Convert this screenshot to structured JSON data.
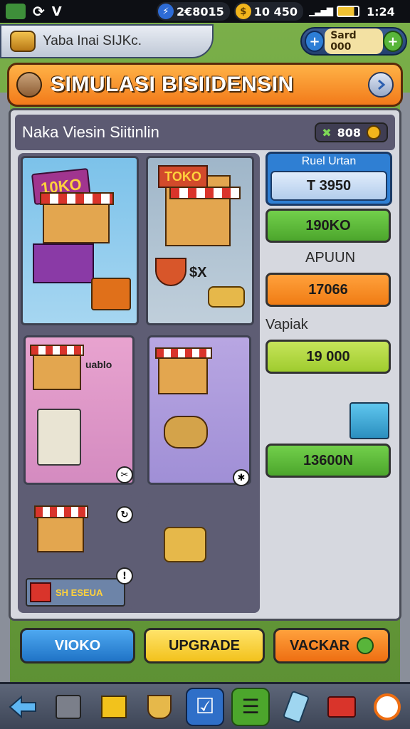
{
  "status_bar": {
    "currency_a": "2€8015",
    "currency_b": "10 450",
    "time": "1:24"
  },
  "header": {
    "account_label": "Yaba Inai SIJKc.",
    "balance": "Sard 000"
  },
  "title_bar": {
    "title": "SIMULASI BISIIDENSIN"
  },
  "panel": {
    "subheading": "Naka Viesin Siitinlin",
    "badge_value": "808",
    "shop_sign": "10KO",
    "shop_sign_2": "TOKO",
    "sx_label": "$X",
    "shop_label": "uablo",
    "coin_label": "SH ESEUA"
  },
  "sidebar": {
    "card_header": "Ruel Urtan",
    "card_value": "T 3950",
    "green_value": "190KO",
    "label_apuun": "APUUN",
    "orange_value": "17066",
    "label_vapiak": "Vapiak",
    "lime_value": "19 000",
    "green_value_2": "13600N"
  },
  "buttons": {
    "left": "VIOKO",
    "middle": "UPGRADE",
    "right": "VACKAR"
  },
  "colors": {
    "title_orange": "#f27a1a",
    "price_green": "#57b833",
    "price_orange": "#f58a1f",
    "price_lime": "#a9d63a",
    "button_blue": "#2e8fe0",
    "button_yellow": "#f7d53c"
  }
}
